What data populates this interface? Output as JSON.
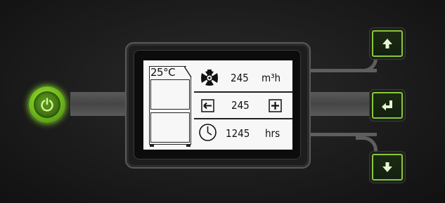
{
  "display": {
    "temperature": "25°C",
    "fan_speed": {
      "value": "245",
      "unit": "m³h"
    },
    "setpoint": {
      "value": "245"
    },
    "timer": {
      "value": "1245",
      "unit": "hrs"
    }
  },
  "icons": {
    "power": "power-icon",
    "fan": "fan-icon",
    "decrease": "minus-icon",
    "increase": "plus-icon",
    "clock": "clock-icon",
    "up": "arrow-up-icon",
    "enter": "enter-icon",
    "down": "arrow-down-icon"
  },
  "colors": {
    "accent_green": "#86c83a",
    "panel": "#1b1b1b",
    "lcd_background": "#f7f7f7"
  }
}
